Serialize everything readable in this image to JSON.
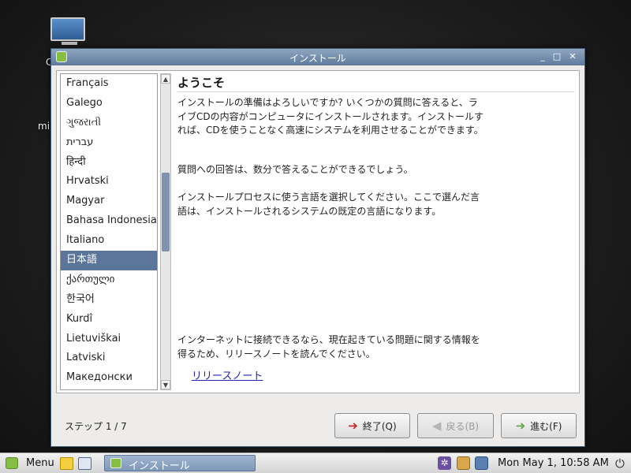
{
  "desktop": {
    "label_1": "C",
    "label_2": "mi"
  },
  "window": {
    "title": "インストール",
    "minimize_glyph": "_",
    "maximize_glyph": "□",
    "close_glyph": "✕"
  },
  "language_list": {
    "items": [
      "Français",
      "Galego",
      "ગુજરાતી",
      "עברית",
      "हिन्दी",
      "Hrvatski",
      "Magyar",
      "Bahasa Indonesia",
      "Italiano",
      "日本語",
      "ქართული",
      "한국어",
      "Kurdî",
      "Lietuviškai",
      "Latviski",
      "Македонски"
    ],
    "selected_index": 9
  },
  "welcome": {
    "heading": "ようこそ",
    "paragraph_1": "インストールの準備はよろしいですか? いくつかの質問に答えると、ライブCDの内容がコンピュータにインストールされます。インストールすれば、CDを使うことなく高速にシステムを利用させることができます。",
    "paragraph_2": "質問への回答は、数分で答えることができるでしょう。",
    "paragraph_3": "インストールプロセスに使う言語を選択してください。ここで選んだ言語は、インストールされるシステムの既定の言語になります。",
    "paragraph_4": "インターネットに接続できるなら、現在起きている問題に関する情報を得るため、リリースノートを読んでください。",
    "release_notes_link": "リリースノート"
  },
  "footer": {
    "step": "ステップ 1 / 7",
    "quit_label": "終了(Q)",
    "back_label": "戻る(B)",
    "forward_label": "進む(F)"
  },
  "icons": {
    "quit": "exit-door-icon",
    "back": "arrow-left-icon",
    "forward": "arrow-right-icon"
  },
  "taskbar": {
    "menu_label": "Menu",
    "task_label": "インストール",
    "clock": "Mon May  1, 10:58 AM",
    "power_glyph": "⏻",
    "gear_glyph": "✲"
  },
  "colors": {
    "titlebar": "#5f7b9c",
    "selection": "#5b7698",
    "mint_green": "#86be43"
  }
}
